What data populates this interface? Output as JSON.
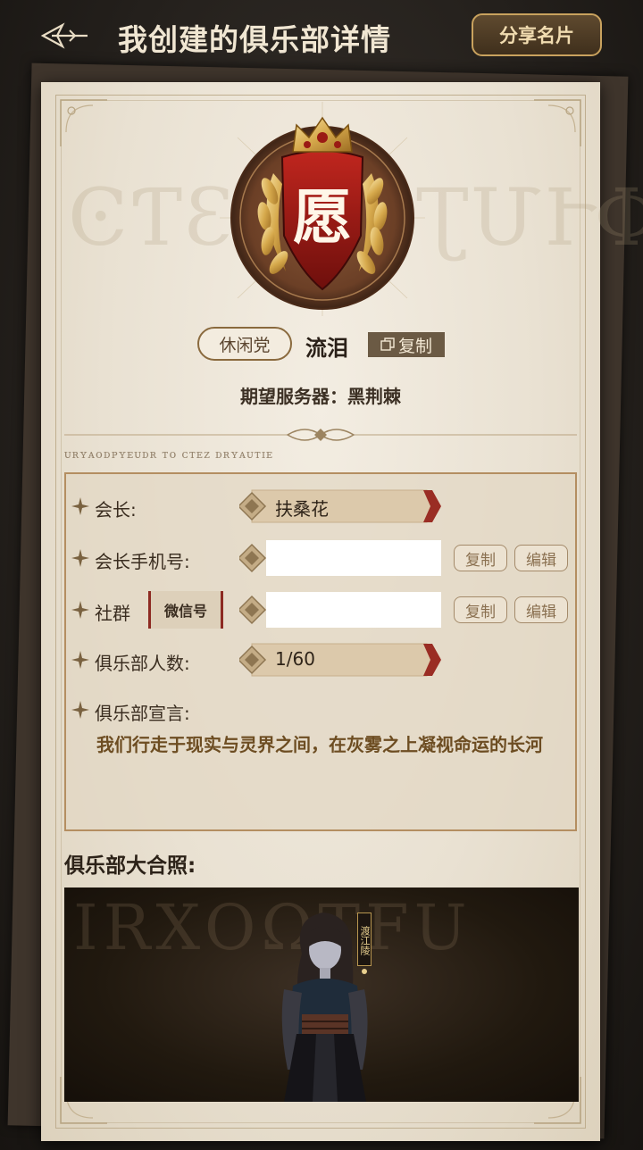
{
  "header": {
    "title": "我创建的俱乐部详情",
    "share_label": "分享名片"
  },
  "club": {
    "emblem_char": "愿",
    "tag": "休闲党",
    "name": "流泪",
    "copy_label": "复制",
    "server_text": "期望服务器：黑荆棘",
    "watermark_left": "ϾƬƐƵ",
    "watermark_right": "ƮՄՒΦ",
    "rune_line": "ᴜʀʏᴀᴏᴅᴘʏᴇᴜᴅʀ ᴛᴏ ᴄᴛᴇᴢ ᴅʀʏᴀᴜᴛɪᴇ"
  },
  "info": {
    "leader_label": "会长:",
    "leader_value": "扶桑花",
    "phone_label": "会长手机号:",
    "phone_copy": "复制",
    "phone_edit": "编辑",
    "community_label": "社群",
    "community_type": "微信号",
    "community_copy": "复制",
    "community_edit": "编辑",
    "members_label": "俱乐部人数:",
    "members_value": "1/60",
    "manifesto_label": "俱乐部宣言:",
    "manifesto_text": "我们行走于现实与灵界之间，在灰雾之上凝视命运的长河"
  },
  "photo": {
    "label": "俱乐部大合照:",
    "character_name": "渡江陵",
    "watermark": "IRXOΩTFU"
  },
  "colors": {
    "accent_gold": "#c9a25e",
    "accent_red": "#8d2a22",
    "paper": "#ece4d6"
  },
  "icons": [
    "back-arrow-icon",
    "copy-icon",
    "star-bullet-icon",
    "diamond-icon",
    "crown-icon",
    "laurel-icon"
  ]
}
